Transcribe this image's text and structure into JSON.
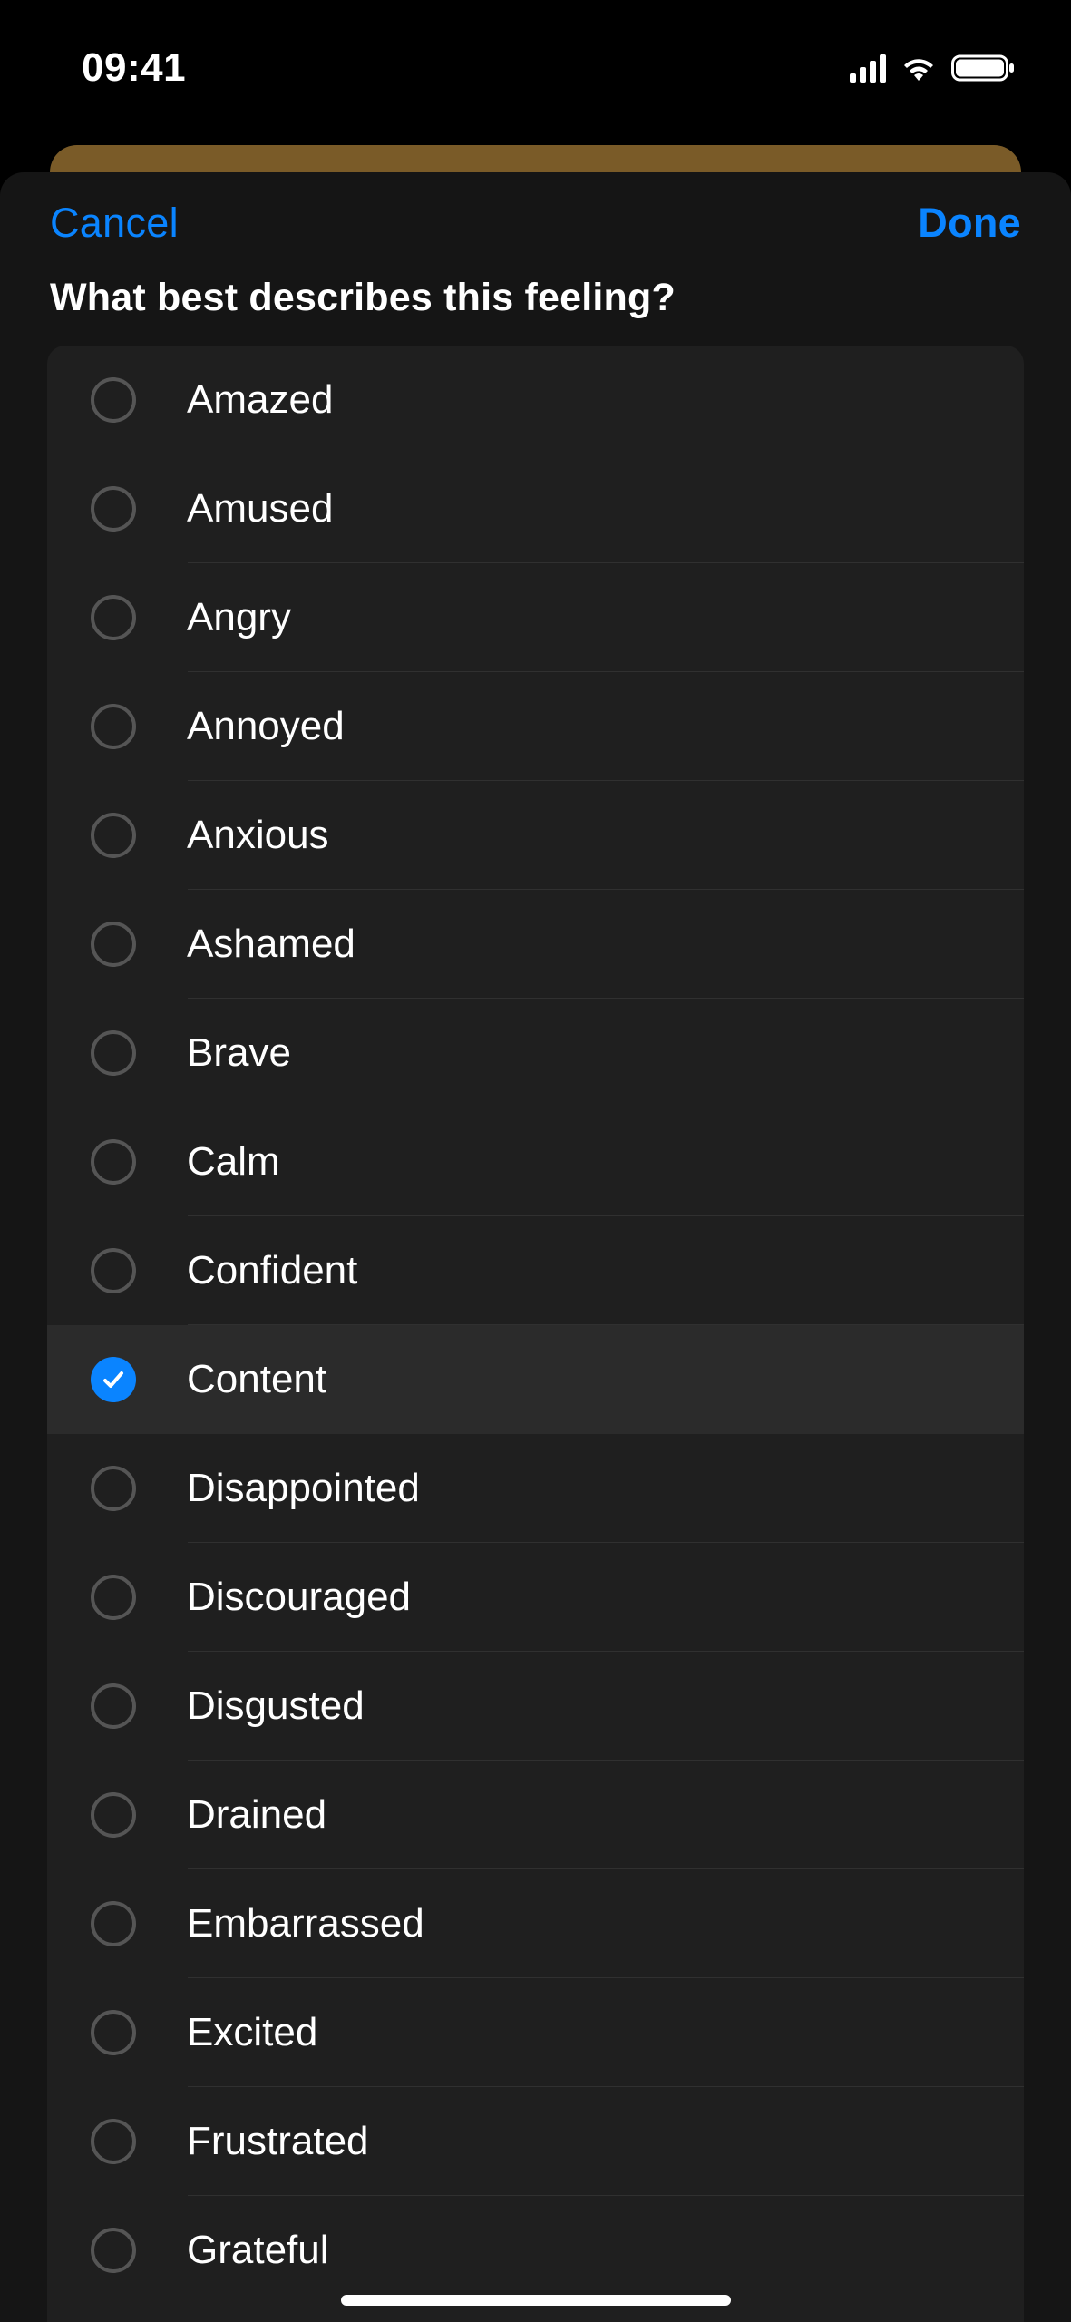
{
  "status": {
    "time": "09:41"
  },
  "modal": {
    "cancel_label": "Cancel",
    "done_label": "Done",
    "title": "What best describes this feeling?"
  },
  "feelings": [
    {
      "label": "Amazed",
      "selected": false
    },
    {
      "label": "Amused",
      "selected": false
    },
    {
      "label": "Angry",
      "selected": false
    },
    {
      "label": "Annoyed",
      "selected": false
    },
    {
      "label": "Anxious",
      "selected": false
    },
    {
      "label": "Ashamed",
      "selected": false
    },
    {
      "label": "Brave",
      "selected": false
    },
    {
      "label": "Calm",
      "selected": false
    },
    {
      "label": "Confident",
      "selected": false
    },
    {
      "label": "Content",
      "selected": true
    },
    {
      "label": "Disappointed",
      "selected": false
    },
    {
      "label": "Discouraged",
      "selected": false
    },
    {
      "label": "Disgusted",
      "selected": false
    },
    {
      "label": "Drained",
      "selected": false
    },
    {
      "label": "Embarrassed",
      "selected": false
    },
    {
      "label": "Excited",
      "selected": false
    },
    {
      "label": "Frustrated",
      "selected": false
    },
    {
      "label": "Grateful",
      "selected": false
    }
  ]
}
